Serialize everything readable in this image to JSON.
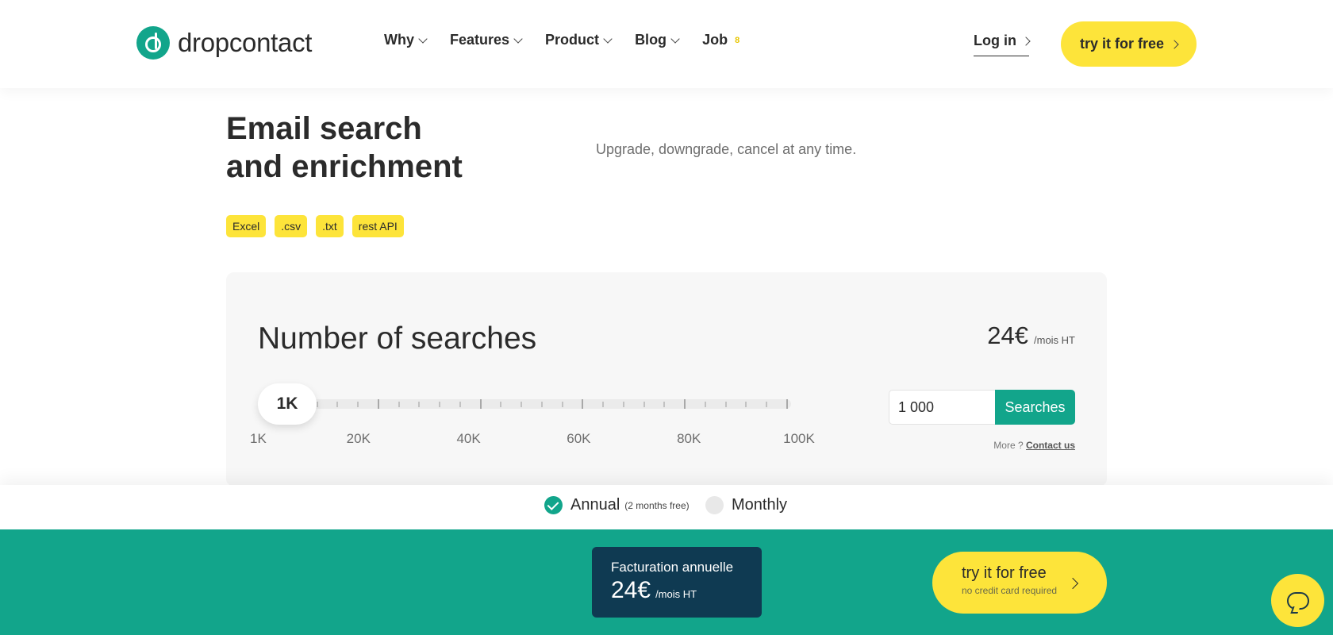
{
  "header": {
    "logo_text": "dropcontact",
    "nav": [
      {
        "label": "Why"
      },
      {
        "label": "Features"
      },
      {
        "label": "Product"
      },
      {
        "label": "Blog"
      },
      {
        "label": "Job",
        "badge": "8"
      }
    ],
    "login_label": "Log in",
    "cta_label": "try it for free"
  },
  "hero": {
    "title_line1": "Email search",
    "title_line2": "and enrichment",
    "subtitle": "Upgrade, downgrade, cancel at any time.",
    "tags": [
      "Excel",
      ".csv",
      ".txt",
      "rest API"
    ]
  },
  "pricing_card": {
    "title": "Number of searches",
    "price": "24€",
    "price_unit": "/mois HT",
    "slider": {
      "value_label": "1K",
      "value": 1000,
      "min": 1000,
      "max": 100000,
      "scale_labels": [
        "1K",
        "20K",
        "40K",
        "60K",
        "80K",
        "100K"
      ]
    },
    "searches_input_value": "1 000",
    "searches_button_label": "Searches",
    "more_text": "More ?",
    "contact_link": "Contact us"
  },
  "billing_toggle": {
    "annual_label": "Annual",
    "annual_note": "(2 months free)",
    "monthly_label": "Monthly",
    "selected": "annual"
  },
  "bottom_bar": {
    "billing_label": "Facturation annuelle",
    "billing_price": "24€",
    "billing_unit": "/mois HT",
    "cta_label": "try it for free",
    "cta_sub": "no credit card required"
  },
  "colors": {
    "brand_green": "#12a58b",
    "brand_yellow": "#fde43a",
    "dark_navy": "#0f3a52"
  }
}
